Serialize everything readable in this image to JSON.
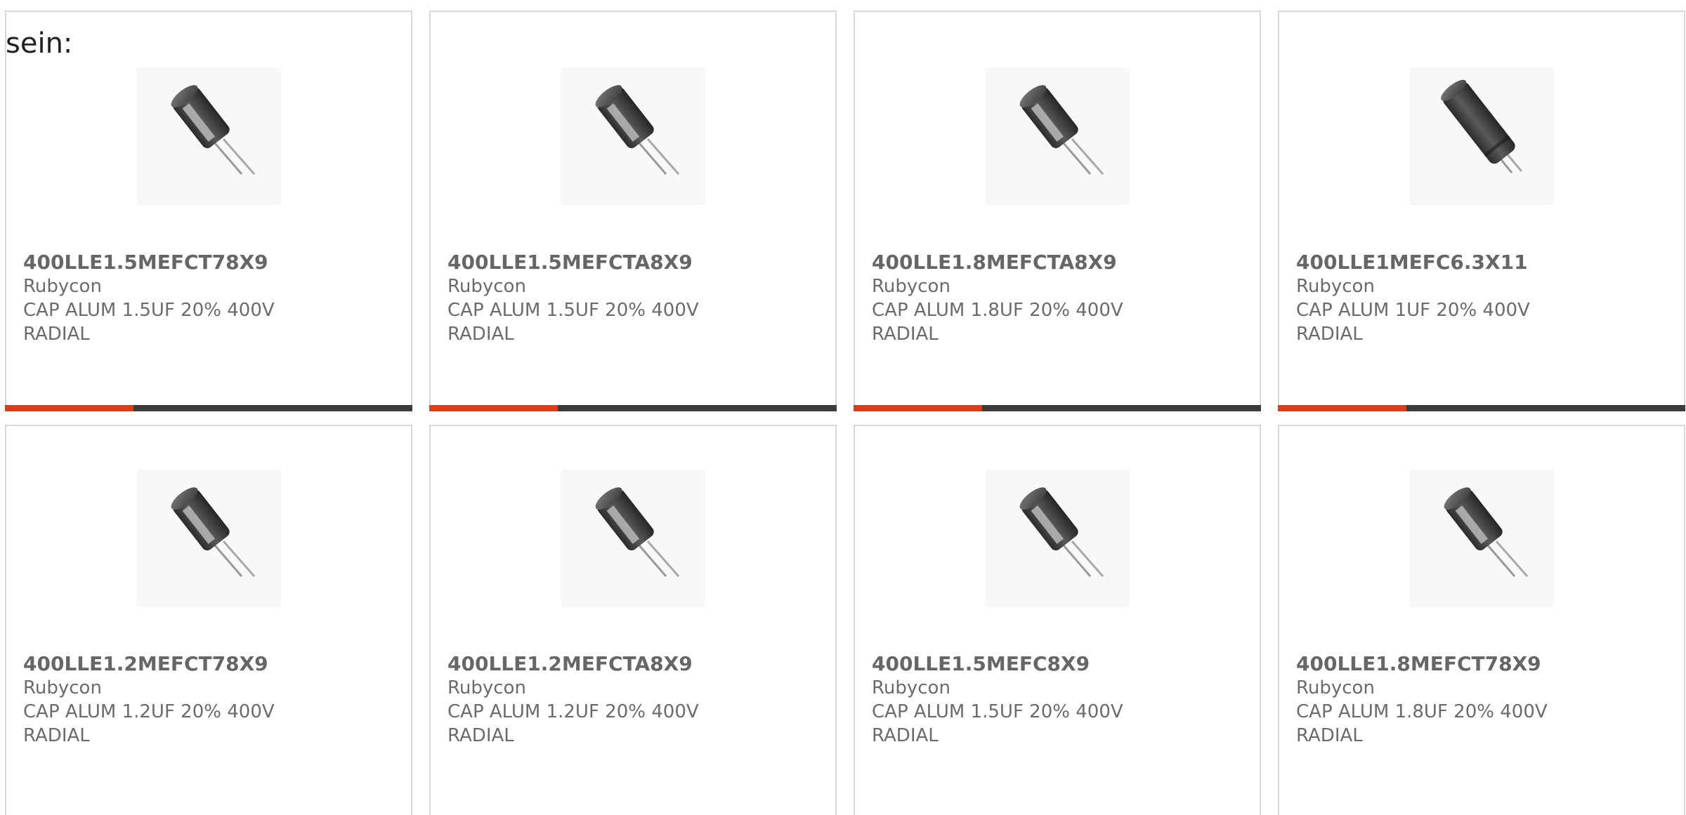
{
  "intro_text": "sein:",
  "colors": {
    "accent": "#e8380d",
    "bar": "#3b3b3b",
    "card_border": "#d8d8d8",
    "text": "#6b6b6b"
  },
  "products": [
    {
      "part_number": "400LLE1.5MEFCT78X9",
      "manufacturer": "Rubycon",
      "description_line1": "CAP ALUM 1.5UF 20% 400V",
      "description_line2": "RADIAL",
      "image_icon": "radial-capacitor-icon"
    },
    {
      "part_number": "400LLE1.5MEFCTA8X9",
      "manufacturer": "Rubycon",
      "description_line1": "CAP ALUM 1.5UF 20% 400V",
      "description_line2": "RADIAL",
      "image_icon": "radial-capacitor-icon"
    },
    {
      "part_number": "400LLE1.8MEFCTA8X9",
      "manufacturer": "Rubycon",
      "description_line1": "CAP ALUM 1.8UF 20% 400V",
      "description_line2": "RADIAL",
      "image_icon": "radial-capacitor-icon"
    },
    {
      "part_number": "400LLE1MEFC6.3X11",
      "manufacturer": "Rubycon",
      "description_line1": "CAP ALUM 1UF 20% 400V",
      "description_line2": "RADIAL",
      "image_icon": "radial-capacitor-long-icon"
    },
    {
      "part_number": "400LLE1.2MEFCT78X9",
      "manufacturer": "Rubycon",
      "description_line1": "CAP ALUM 1.2UF 20% 400V",
      "description_line2": "RADIAL",
      "image_icon": "radial-capacitor-icon"
    },
    {
      "part_number": "400LLE1.2MEFCTA8X9",
      "manufacturer": "Rubycon",
      "description_line1": "CAP ALUM 1.2UF 20% 400V",
      "description_line2": "RADIAL",
      "image_icon": "radial-capacitor-icon"
    },
    {
      "part_number": "400LLE1.5MEFC8X9",
      "manufacturer": "Rubycon",
      "description_line1": "CAP ALUM 1.5UF 20% 400V",
      "description_line2": "RADIAL",
      "image_icon": "radial-capacitor-icon"
    },
    {
      "part_number": "400LLE1.8MEFCT78X9",
      "manufacturer": "Rubycon",
      "description_line1": "CAP ALUM 1.8UF 20% 400V",
      "description_line2": "RADIAL",
      "image_icon": "radial-capacitor-icon"
    }
  ]
}
